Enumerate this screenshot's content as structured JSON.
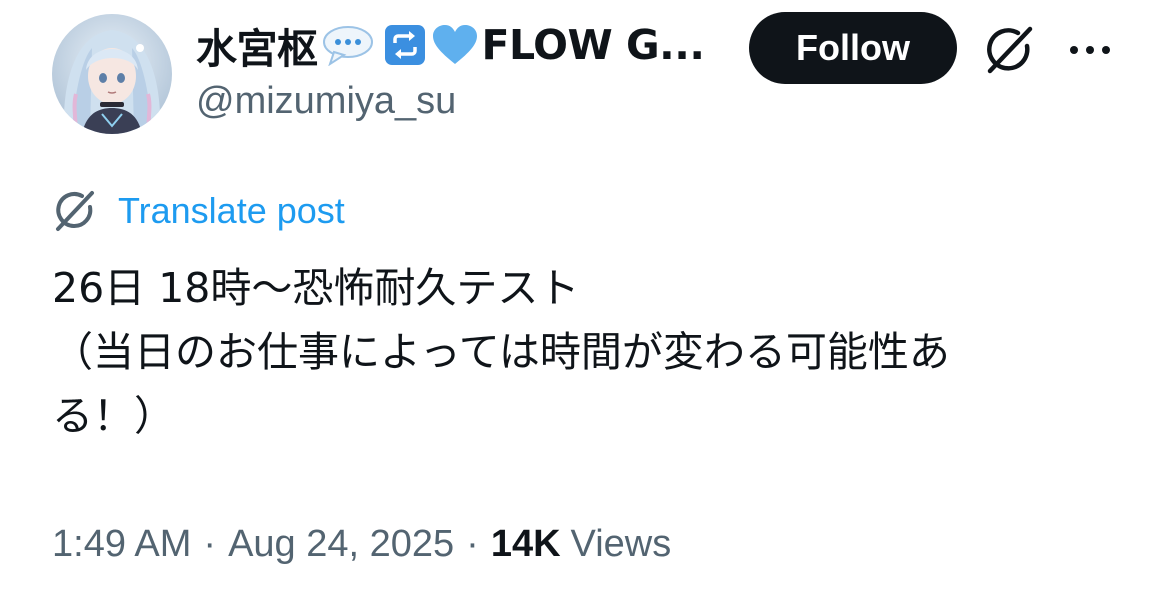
{
  "author": {
    "display_name": "水宮枢",
    "display_name_tail": "FLOW G...",
    "handle": "@mizumiya_su",
    "name_emojis": [
      "speech-bubble-emoji",
      "repeat-button-emoji",
      "light-blue-heart-emoji"
    ]
  },
  "actions": {
    "follow_label": "Follow",
    "grok_icon": "grok-icon",
    "more_icon": "more-dots-icon"
  },
  "translate": {
    "label": "Translate post",
    "icon": "grok-icon"
  },
  "post": {
    "lines": [
      "26日 18時〜恐怖耐久テスト",
      "（当日のお仕事によっては時間が変わる可能性あ",
      "る！）"
    ]
  },
  "meta": {
    "time": "1:49 AM",
    "separator": "·",
    "date": "Aug 24, 2025",
    "views_count": "14K",
    "views_label": "Views"
  },
  "colors": {
    "text_primary": "#0f1419",
    "text_secondary": "#536471",
    "link_blue": "#1d9bf0",
    "follow_bg": "#0f1419",
    "follow_text": "#ffffff"
  }
}
